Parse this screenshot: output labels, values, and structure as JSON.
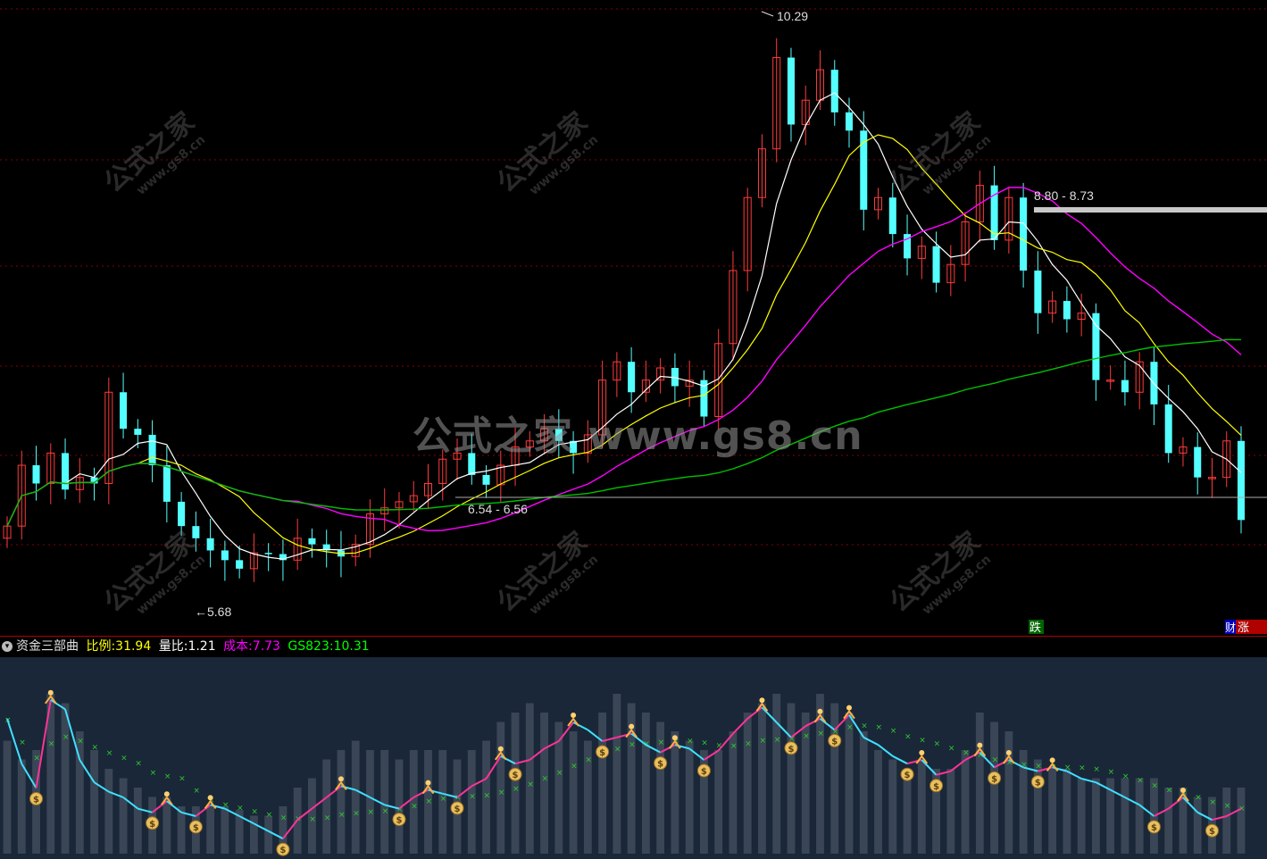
{
  "watermark": {
    "center": "公式之家 www.gs8.cn",
    "small_cn": "公式之家",
    "small_url": "www.gs8.cn"
  },
  "main_labels": {
    "high_label": "10.29",
    "low_label": "←5.68",
    "range_upper": "8.80 - 8.73",
    "range_lower": "6.54 - 6.56",
    "badge_fall": "跌",
    "badge_finance": "财",
    "badge_rise": "涨"
  },
  "indicator": {
    "name": "资金三部曲",
    "ratio_label": "比例:",
    "ratio_value": "31.94",
    "volratio_label": "量比:",
    "volratio_value": "1.21",
    "cost_label": "成本:",
    "cost_value": "7.73",
    "gs_label": "GS823:",
    "gs_value": "10.31"
  },
  "colors": {
    "up": "#ff3b3b",
    "down": "#54ffff",
    "ma5": "#ffffff",
    "ma10": "#ffff00",
    "ma20": "#ff00ff",
    "ma60": "#00c000",
    "grid": "#8a0000",
    "sub_bg": "#1a2738",
    "sub_bar": "#3a4656",
    "line_up": "#ff3399",
    "line_down": "#40e0ff",
    "cross": "#2ecc2e",
    "cost": "#ff00ff",
    "ratio": "#ffff00",
    "gs": "#00ff00"
  },
  "chart_data": [
    {
      "type": "candlestick",
      "title": "",
      "ylim": [
        5.35,
        10.45
      ],
      "annotations": [
        {
          "text": "10.29",
          "value": 10.29
        },
        {
          "text": "←5.68",
          "value": 5.68
        },
        {
          "text": "8.80 - 8.73",
          "value": [
            8.8,
            8.73
          ]
        },
        {
          "text": "6.54 - 6.56",
          "value": [
            6.54,
            6.56
          ]
        }
      ],
      "closes": [
        6.2,
        6.7,
        6.55,
        6.8,
        6.5,
        6.6,
        6.55,
        7.3,
        7.0,
        6.95,
        6.7,
        6.4,
        6.2,
        6.1,
        6.0,
        5.92,
        5.85,
        5.98,
        5.97,
        5.92,
        6.1,
        6.05,
        6.0,
        5.95,
        6.05,
        6.3,
        6.35,
        6.4,
        6.45,
        6.55,
        6.75,
        6.8,
        6.62,
        6.54,
        6.7,
        6.85,
        6.9,
        7.0,
        6.9,
        6.8,
        6.95,
        7.4,
        7.55,
        7.3,
        7.4,
        7.5,
        7.35,
        7.4,
        7.1,
        7.7,
        8.3,
        8.9,
        9.3,
        10.05,
        9.5,
        9.7,
        9.95,
        9.6,
        9.45,
        8.8,
        8.9,
        8.6,
        8.4,
        8.5,
        8.2,
        8.35,
        8.7,
        9.0,
        8.55,
        8.9,
        8.3,
        7.95,
        8.05,
        7.9,
        7.95,
        7.4,
        7.4,
        7.3,
        7.55,
        7.2,
        6.8,
        6.85,
        6.6,
        6.6,
        6.9,
        6.25
      ],
      "ma_periods": [
        5,
        10,
        20,
        60
      ]
    },
    {
      "type": "bar+line",
      "title": "资金三部曲",
      "series": [
        {
          "name": "比例",
          "last": 31.94
        },
        {
          "name": "量比",
          "last": 1.21
        },
        {
          "name": "成本",
          "last": 7.73
        },
        {
          "name": "GS823",
          "last": 10.31
        }
      ],
      "line": [
        0.72,
        0.48,
        0.35,
        0.82,
        0.77,
        0.5,
        0.38,
        0.33,
        0.3,
        0.24,
        0.22,
        0.28,
        0.22,
        0.2,
        0.26,
        0.24,
        0.2,
        0.16,
        0.12,
        0.08,
        0.18,
        0.24,
        0.3,
        0.36,
        0.34,
        0.3,
        0.26,
        0.24,
        0.3,
        0.34,
        0.32,
        0.3,
        0.36,
        0.4,
        0.52,
        0.48,
        0.5,
        0.56,
        0.6,
        0.7,
        0.66,
        0.6,
        0.62,
        0.64,
        0.58,
        0.54,
        0.58,
        0.56,
        0.5,
        0.55,
        0.64,
        0.72,
        0.78,
        0.7,
        0.62,
        0.68,
        0.72,
        0.66,
        0.74,
        0.62,
        0.58,
        0.52,
        0.48,
        0.5,
        0.42,
        0.44,
        0.5,
        0.54,
        0.46,
        0.5,
        0.46,
        0.44,
        0.46,
        0.44,
        0.4,
        0.38,
        0.34,
        0.3,
        0.26,
        0.2,
        0.24,
        0.3,
        0.22,
        0.18,
        0.2,
        0.24
      ],
      "volume": [
        0.65,
        0.55,
        0.6,
        0.9,
        0.85,
        0.7,
        0.6,
        0.5,
        0.45,
        0.4,
        0.35,
        0.35,
        0.3,
        0.3,
        0.3,
        0.3,
        0.28,
        0.25,
        0.25,
        0.3,
        0.4,
        0.45,
        0.55,
        0.6,
        0.65,
        0.6,
        0.6,
        0.55,
        0.6,
        0.6,
        0.6,
        0.55,
        0.6,
        0.65,
        0.75,
        0.8,
        0.85,
        0.8,
        0.75,
        0.7,
        0.65,
        0.8,
        0.9,
        0.85,
        0.8,
        0.75,
        0.7,
        0.65,
        0.6,
        0.6,
        0.7,
        0.8,
        0.85,
        0.9,
        0.85,
        0.8,
        0.9,
        0.85,
        0.8,
        0.7,
        0.6,
        0.55,
        0.5,
        0.55,
        0.5,
        0.5,
        0.6,
        0.8,
        0.75,
        0.7,
        0.6,
        0.55,
        0.5,
        0.5,
        0.45,
        0.45,
        0.45,
        0.45,
        0.45,
        0.45,
        0.4,
        0.4,
        0.35,
        0.35,
        0.4,
        0.4
      ]
    }
  ]
}
